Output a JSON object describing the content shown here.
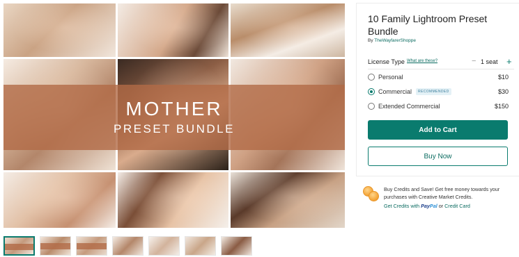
{
  "gallery": {
    "banner_title": "MOTHER",
    "banner_subtitle": "PRESET BUNDLE"
  },
  "thumbnails": {
    "count": 7,
    "active_index": 0
  },
  "product": {
    "title": "10 Family Lightroom Preset Bundle",
    "by_prefix": "By ",
    "shop_name": "TheWayfarerShoppe"
  },
  "license": {
    "label": "License Type",
    "help_link": "What are these?",
    "seat_minus": "−",
    "seat_count": "1 seat",
    "seat_plus": "+",
    "options": [
      {
        "label": "Personal",
        "price": "$10",
        "selected": false
      },
      {
        "label": "Commercial",
        "price": "$30",
        "selected": true,
        "badge": "RECOMMENDED"
      },
      {
        "label": "Extended Commercial",
        "price": "$150",
        "selected": false
      }
    ]
  },
  "actions": {
    "add_to_cart": "Add to Cart",
    "buy_now": "Buy Now"
  },
  "credits": {
    "promo_text": "Buy Credits and Save! Get free money towards your purchases with Creative Market Credits.",
    "link_prefix": "Get Credits with ",
    "paypal_pay": "Pay",
    "paypal_pal": "Pal",
    "or_text": " or ",
    "credit_card": "Credit Card"
  },
  "colors": {
    "accent": "#0a7b6e",
    "banner": "#b26a46",
    "badge_bg": "#e4f1f6"
  },
  "icons": [
    "coins-icon",
    "radio-icon",
    "plus-icon",
    "minus-icon",
    "paypal-logo"
  ]
}
